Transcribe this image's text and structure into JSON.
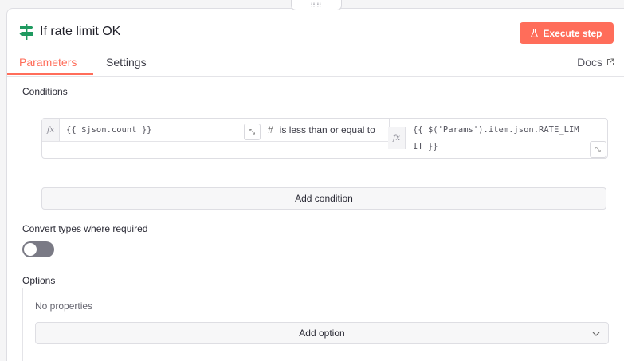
{
  "node": {
    "title": "If rate limit OK",
    "execute_label": "Execute step"
  },
  "tabs": [
    {
      "label": "Parameters"
    },
    {
      "label": "Settings"
    }
  ],
  "docs_label": "Docs",
  "conditions": {
    "section_label": "Conditions",
    "left_value": "{{ $json.count }}",
    "operator_type_glyph": "#",
    "operator_label": "is less than or equal to",
    "right_value_line1": "{{ $('Params').item.json.RATE_LIM",
    "right_value_line2": "IT }}",
    "fx_label": "fx",
    "add_condition_label": "Add condition"
  },
  "convert_types": {
    "label": "Convert types where required",
    "enabled": false
  },
  "options": {
    "section_label": "Options",
    "empty_text": "No properties",
    "add_option_label": "Add option"
  },
  "colors": {
    "accent": "#ff6d5a",
    "node_icon": "#1f9a60"
  }
}
